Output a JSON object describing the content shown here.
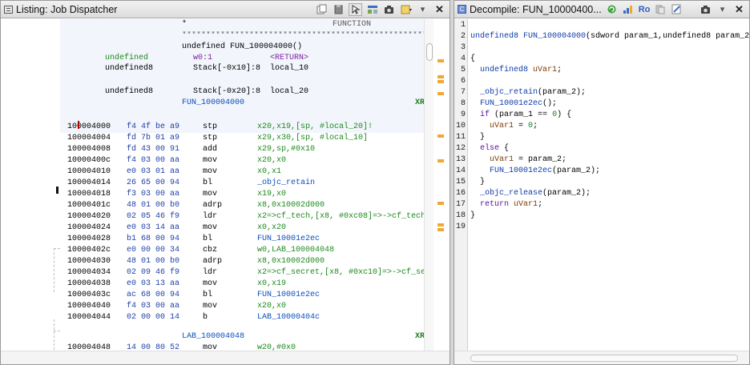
{
  "listing": {
    "title": "Listing:  Job Dispatcher",
    "toolbar_icons": [
      "copy-icon",
      "paste-icon",
      "cursor-icon",
      "field-layout-icon",
      "snapshot-icon",
      "view-menu-icon",
      "dropdown-icon",
      "close-icon"
    ],
    "header": {
      "star": "*",
      "function_label": "FUNCTION",
      "stars": "*************************************************************",
      "signature": "undefined FUN_100004000()",
      "vars": [
        {
          "type": "undefined",
          "loc": "w0:1",
          "name": "<RETURN>"
        },
        {
          "type": "undefined8",
          "loc": "Stack[-0x10]:8",
          "name": "local_10"
        },
        {
          "type": "undefined8",
          "loc": "Stack[-0x20]:8",
          "name": "local_20"
        }
      ],
      "func_label": "FUN_100004000",
      "xref": "XR"
    },
    "instructions": [
      {
        "addr": "100004000",
        "bytes": "f4 4f be a9",
        "mnem": "stp",
        "ops": "x20,x19,[sp, #local_20]!"
      },
      {
        "addr": "100004004",
        "bytes": "fd 7b 01 a9",
        "mnem": "stp",
        "ops": "x29,x30,[sp, #local_10]"
      },
      {
        "addr": "100004008",
        "bytes": "fd 43 00 91",
        "mnem": "add",
        "ops": "x29,sp,#0x10"
      },
      {
        "addr": "10000400c",
        "bytes": "f4 03 00 aa",
        "mnem": "mov",
        "ops": "x20,x0"
      },
      {
        "addr": "100004010",
        "bytes": "e0 03 01 aa",
        "mnem": "mov",
        "ops": "x0,x1"
      },
      {
        "addr": "100004014",
        "bytes": "26 65 00 94",
        "mnem": "bl",
        "ops": "_objc_retain"
      },
      {
        "addr": "100004018",
        "bytes": "f3 03 00 aa",
        "mnem": "mov",
        "ops": "x19,x0"
      },
      {
        "addr": "10000401c",
        "bytes": "48 01 00 b0",
        "mnem": "adrp",
        "ops": "x8,0x10002d000"
      },
      {
        "addr": "100004020",
        "bytes": "02 05 46 f9",
        "mnem": "ldr",
        "ops": "x2=>cf_tech,[x8, #0xc08]=>->cf_tech"
      },
      {
        "addr": "100004024",
        "bytes": "e0 03 14 aa",
        "mnem": "mov",
        "ops": "x0,x20"
      },
      {
        "addr": "100004028",
        "bytes": "b1 68 00 94",
        "mnem": "bl",
        "ops": "FUN_10001e2ec"
      },
      {
        "addr": "10000402c",
        "bytes": "e0 00 00 34",
        "mnem": "cbz",
        "ops": "w0,LAB_100004048"
      },
      {
        "addr": "100004030",
        "bytes": "48 01 00 b0",
        "mnem": "adrp",
        "ops": "x8,0x10002d000"
      },
      {
        "addr": "100004034",
        "bytes": "02 09 46 f9",
        "mnem": "ldr",
        "ops": "x2=>cf_secret,[x8, #0xc10]=>->cf_se"
      },
      {
        "addr": "100004038",
        "bytes": "e0 03 13 aa",
        "mnem": "mov",
        "ops": "x0,x19"
      },
      {
        "addr": "10000403c",
        "bytes": "ac 68 00 94",
        "mnem": "bl",
        "ops": "FUN_10001e2ec"
      },
      {
        "addr": "100004040",
        "bytes": "f4 03 00 aa",
        "mnem": "mov",
        "ops": "x20,x0"
      },
      {
        "addr": "100004044",
        "bytes": "02 00 00 14",
        "mnem": "b",
        "ops": "LAB_10000404c"
      }
    ],
    "label2": "LAB_100004048",
    "xref2": "XR",
    "last": {
      "addr": "100004048",
      "bytes": "14 00 80 52",
      "mnem": "mov",
      "ops": "w20,#0x0"
    }
  },
  "decompiler": {
    "title": "Decompile: FUN_10000400...",
    "toolbar_icons": [
      "refresh-icon",
      "graph-icon",
      "ro-icon",
      "copy-icon",
      "edit-icon",
      "snapshot-icon",
      "dropdown-icon",
      "close-icon"
    ],
    "ro_label": "Ro",
    "lines": [
      "1",
      "2",
      "3",
      "4",
      "5",
      "6",
      "7",
      "8",
      "9",
      "10",
      "11",
      "12",
      "13",
      "14",
      "15",
      "16",
      "17",
      "18",
      "19"
    ],
    "code": {
      "l2_type": "undefined8",
      "l2_fn": "FUN_100004000",
      "l2_rest": "(sdword param_1,undefined8 param_2)",
      "l4": "{",
      "l5_type": "undefined8",
      "l5_var": "uVar1",
      "l5_end": ";",
      "l7_fn": "_objc_retain",
      "l7_rest": "(param_2);",
      "l8_fn": "FUN_10001e2ec",
      "l8_rest": "();",
      "l9_kw": "if",
      "l9_p": "(param_1 == ",
      "l9_num": "0",
      "l9_end": ") {",
      "l10_var": "uVar1",
      "l10_mid": " = ",
      "l10_num": "0",
      "l10_end": ";",
      "l11": "}",
      "l12_kw": "else",
      "l12_end": " {",
      "l13_var": "uVar1",
      "l13_rest": " = param_2;",
      "l14_fn": "FUN_10001e2ec",
      "l14_rest": "(param_2);",
      "l15": "}",
      "l16_fn": "_objc_release",
      "l16_rest": "(param_2);",
      "l17_kw": "return",
      "l17_var": "uVar1",
      "l17_end": ";",
      "l18": "}"
    }
  }
}
